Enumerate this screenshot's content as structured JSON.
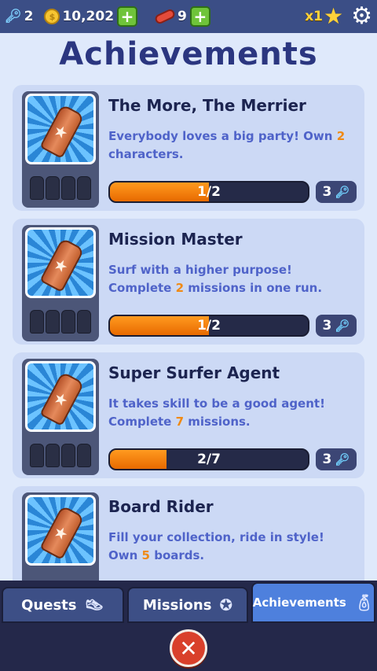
{
  "topbar": {
    "keys": "2",
    "coins": "10,202",
    "boards": "9",
    "multiplier": "x1",
    "icons": {
      "keys": "key-icon",
      "coins": "coin-icon",
      "boards": "hoverboard-icon",
      "add": "plus-icon",
      "multiplier": "star-icon",
      "settings": "gear-icon"
    }
  },
  "page_title": "Achievements",
  "achievements": [
    {
      "title": "The More, The Merrier",
      "desc_line1": "Everybody loves a big party! Own",
      "desc_highlight": "2",
      "desc_line1_end": "",
      "desc_line2": "characters.",
      "progress_text": "1/2",
      "progress_fraction": 0.5,
      "reward": "3"
    },
    {
      "title": "Mission Master",
      "desc_line1": "Surf with a higher purpose!",
      "desc_line2_start": "Complete",
      "desc_highlight": "2",
      "desc_line2_end": "missions in one run.",
      "progress_text": "1/2",
      "progress_fraction": 0.5,
      "reward": "3"
    },
    {
      "title": "Super Surfer Agent",
      "desc_line1": "It takes skill to be a good agent!",
      "desc_line2_start": "Complete",
      "desc_highlight": "7",
      "desc_line2_end": "missions.",
      "progress_text": "2/7",
      "progress_fraction": 0.2857,
      "reward": "3"
    },
    {
      "title": "Board Rider",
      "desc_line1": "Fill your collection, ride in style!",
      "desc_line2_start": "Own",
      "desc_highlight": "5",
      "desc_line2_end": "boards.",
      "progress_text": "",
      "progress_fraction": 0,
      "reward": ""
    }
  ],
  "tabs": [
    {
      "label": "Quests",
      "icon": "sneaker-icon",
      "active": false
    },
    {
      "label": "Missions",
      "icon": "star-badge-icon",
      "active": false
    },
    {
      "label": "Achievements",
      "icon": "spray-can-icon",
      "active": true
    }
  ],
  "colors": {
    "accent_orange": "#f08a14",
    "title_navy": "#2b3680",
    "progress_fill": "#ff9a1f",
    "active_tab": "#4e80dd",
    "close_red": "#d9402b"
  }
}
